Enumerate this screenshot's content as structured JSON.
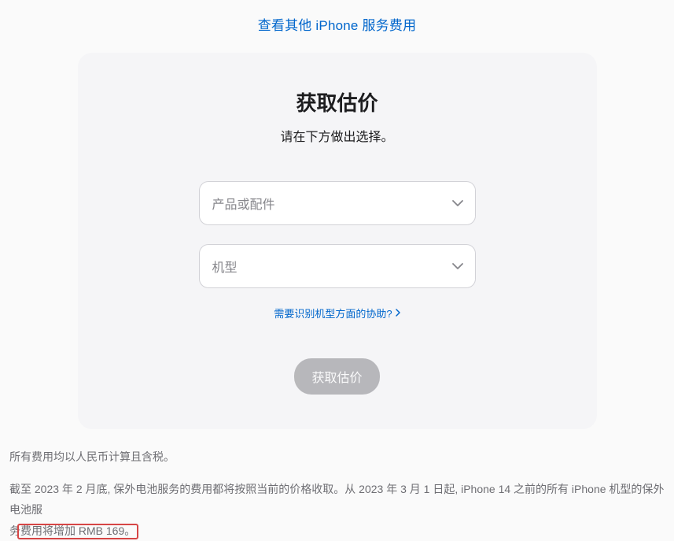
{
  "topLink": {
    "label": "查看其他 iPhone 服务费用"
  },
  "card": {
    "title": "获取估价",
    "subtitle": "请在下方做出选择。",
    "select1": {
      "placeholder": "产品或配件"
    },
    "select2": {
      "placeholder": "机型"
    },
    "helpLink": {
      "label": "需要识别机型方面的协助?"
    },
    "submit": {
      "label": "获取估价"
    }
  },
  "footer": {
    "para1": "所有费用均以人民币计算且含税。",
    "para2_prefix": "截至 2023 年 2 月底, 保外电池服务的费用都将按照当前的价格收取。从 2023 年 3 月 1 日起, iPhone 14 之前的所有 iPhone 机型的保外电池服",
    "para2_line2_prefix": "务",
    "para2_highlight": "费用将增加 RMB 169。"
  }
}
